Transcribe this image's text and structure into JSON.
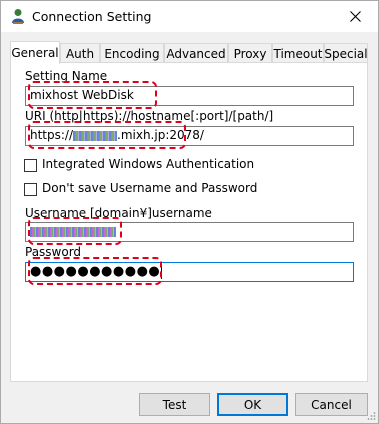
{
  "window": {
    "title": "Connection Setting",
    "icons": {
      "app": "user-globe-icon",
      "close": "close-icon",
      "grip": "resize-grip-icon"
    }
  },
  "tabs": [
    {
      "label": "General",
      "active": true
    },
    {
      "label": "Auth"
    },
    {
      "label": "Encoding"
    },
    {
      "label": "Advanced"
    },
    {
      "label": "Proxy"
    },
    {
      "label": "Timeout"
    },
    {
      "label": "Special"
    }
  ],
  "general": {
    "setting_name_label": "Setting Name",
    "setting_name_value": "mixhost WebDisk",
    "uri_label": "URI  (http|https)://hostname[:port]/[path/]",
    "uri_value_prefix": "https://",
    "uri_value_suffix": ".mixh.jp:2078/",
    "integrated_auth_label": "Integrated Windows Authentication",
    "dont_save_label": "Don't save Username and Password",
    "username_label": "Username  [domain¥]username",
    "username_value": "[redacted]",
    "password_label": "Password",
    "password_value": "●●●●●●●●●●●",
    "integrated_auth_checked": false,
    "dont_save_checked": false
  },
  "buttons": {
    "test": "Test",
    "ok": "OK",
    "cancel": "Cancel"
  },
  "colors": {
    "highlight": "#e0001b",
    "focus": "#0078d7"
  }
}
